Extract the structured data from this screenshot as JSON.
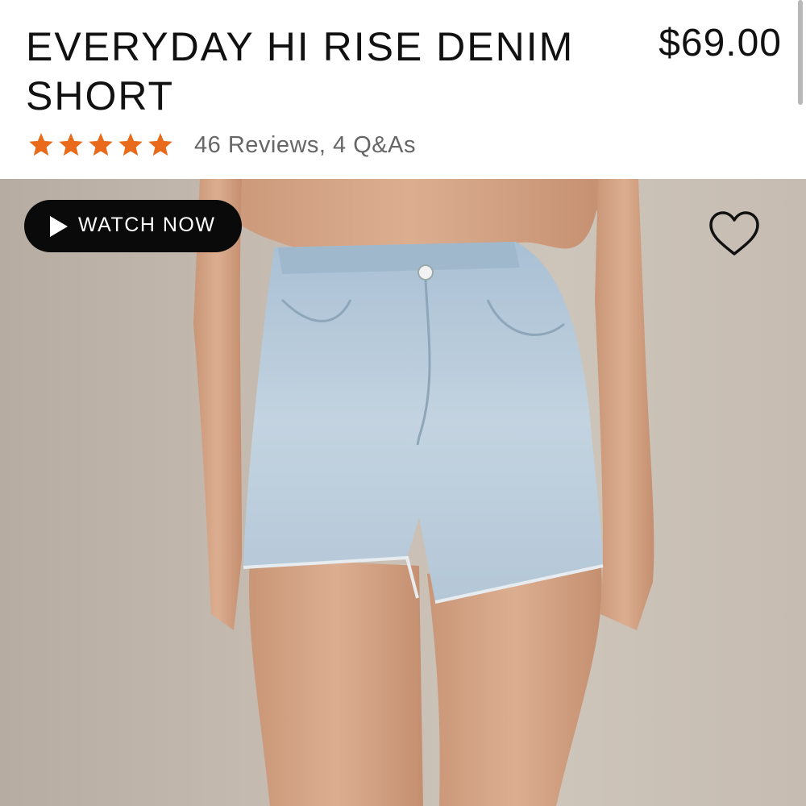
{
  "product": {
    "title": "EVERYDAY HI RISE DENIM SHORT",
    "price": "$69.00",
    "rating": {
      "stars": 5,
      "out_of": 5,
      "star_color": "#e86a1a"
    },
    "reviews_text": "46 Reviews, 4 Q&As"
  },
  "media": {
    "watch_label": "WATCH NOW",
    "play_icon": "play-icon",
    "favorite_icon": "heart-outline-icon"
  }
}
